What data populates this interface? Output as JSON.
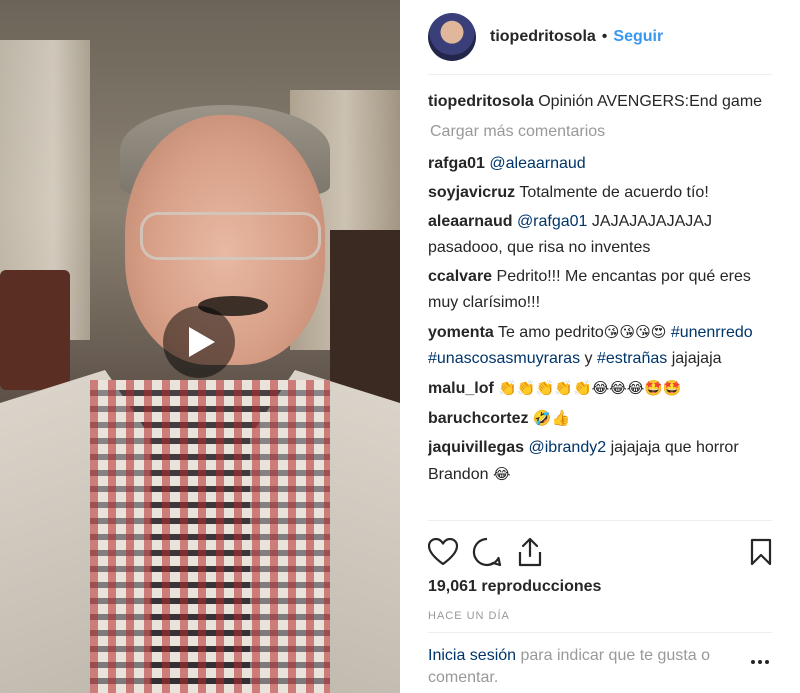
{
  "post": {
    "username": "tiopedritosola",
    "separator": "•",
    "follow_label": "Seguir",
    "caption": "Opinión AVENGERS:End game",
    "load_more": "Cargar más comentarios",
    "views": "19,061 reproducciones",
    "age": "HACE UN DÍA"
  },
  "comments": [
    {
      "user": "rafga01",
      "mention": "@aleaarnaud",
      "text": ""
    },
    {
      "user": "soyjavicruz",
      "mention": "",
      "text": "Totalmente de acuerdo tío!"
    },
    {
      "user": "aleaarnaud",
      "mention": "@rafga01",
      "text": "JAJAJAJAJAJAJ pasadooo, que risa no inventes"
    },
    {
      "user": "ccalvare",
      "mention": "",
      "text": "Pedrito!!! Me encantas por qué eres muy clarísimo!!!"
    },
    {
      "user": "yomenta",
      "text_before": "Te amo pedrito",
      "emoji": "😘😘😘😍",
      "tag1": "#unenrredo",
      "tag2": "#unascosasmuyraras",
      "and": "y",
      "tag3": "#estrañas",
      "text_after": "jajajaja"
    },
    {
      "user": "malu_lof",
      "emoji": "👏👏👏👏👏😂😂😂🤩🤩"
    },
    {
      "user": "baruchcortez",
      "emoji": "🤣👍"
    },
    {
      "user": "jaquivillegas",
      "mention": "@ibrandy2",
      "text": "jajajaja que horror Brandon",
      "emoji": "😂"
    }
  ],
  "login_prompt": {
    "link": "Inicia sesión",
    "text": "para indicar que te gusta o comentar."
  },
  "icons": {
    "play": "play-icon",
    "like": "heart-icon",
    "comment": "comment-icon",
    "share": "share-icon",
    "save": "bookmark-icon",
    "more": "more-options-icon"
  },
  "colors": {
    "link_blue": "#3897f0",
    "mention_blue": "#003569",
    "muted": "#999999"
  }
}
